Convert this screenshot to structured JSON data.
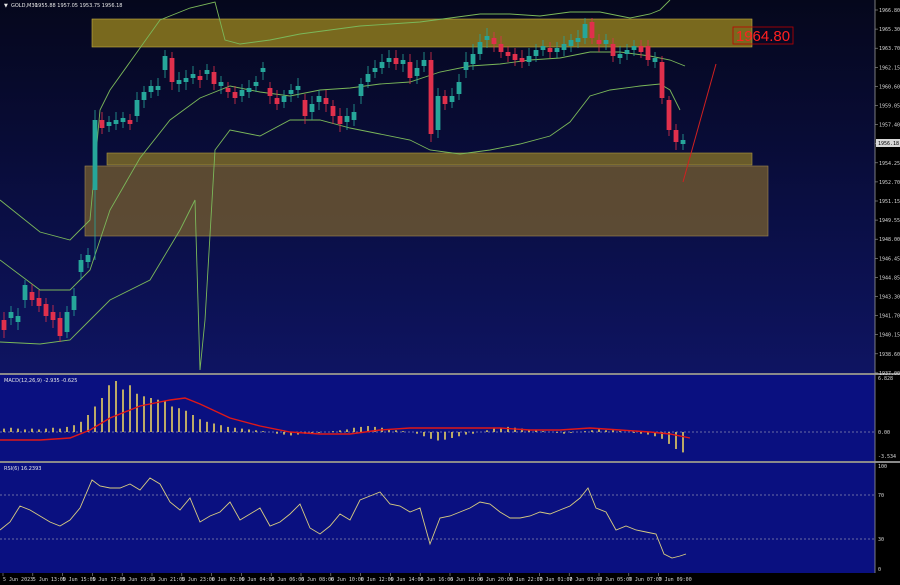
{
  "header": {
    "arrow_glyph": "▼",
    "symbol": "GOLD,M30",
    "ohlc": "1955.88 1957.05 1953.75 1956.18"
  },
  "price_panel": {
    "price_labels": [
      "1966.80",
      "1965.30",
      "1963.70",
      "1962.15",
      "1960.60",
      "1959.05",
      "1957.40",
      "1955.85",
      "1954.25",
      "1952.70",
      "1951.15",
      "1949.55",
      "1948.00",
      "1946.45",
      "1944.85",
      "1943.30",
      "1941.70",
      "1940.15",
      "1938.60",
      "1937.00"
    ],
    "current_price": "1956.18",
    "resistance_label": "1964.80",
    "colors": {
      "bull": "#26a69a",
      "bear": "#e0304c",
      "bands": "#7bb85a",
      "zone": "#a08a1e",
      "zone_dark": "#7a6420",
      "label": "#ff2020"
    }
  },
  "macd_panel": {
    "title": "MACD(12,26,9) -2.935 -0.625",
    "axis_labels": [
      "6.828",
      "0.00",
      "-3.534"
    ],
    "colors": {
      "hist": "#e8d060",
      "signal": "#e01818"
    }
  },
  "rsi_panel": {
    "title": "RSI(6) 16.2393",
    "axis_labels": [
      "100",
      "70",
      "30",
      "0"
    ],
    "colors": {
      "line": "#d8cc80"
    }
  },
  "time_axis": {
    "labels": [
      "5 Jun 2023",
      "5 Jun 13:00",
      "5 Jun 15:00",
      "5 Jun 17:00",
      "5 Jun 19:00",
      "5 Jun 21:00",
      "5 Jun 23:00",
      "6 Jun 02:00",
      "6 Jun 04:00",
      "6 Jun 06:00",
      "6 Jun 08:00",
      "6 Jun 10:00",
      "6 Jun 12:00",
      "6 Jun 14:00",
      "6 Jun 16:00",
      "6 Jun 18:00",
      "6 Jun 20:00",
      "6 Jun 22:00",
      "7 Jun 01:00",
      "7 Jun 03:00",
      "7 Jun 05:00",
      "7 Jun 07:00",
      "7 Jun 09:00"
    ]
  }
}
